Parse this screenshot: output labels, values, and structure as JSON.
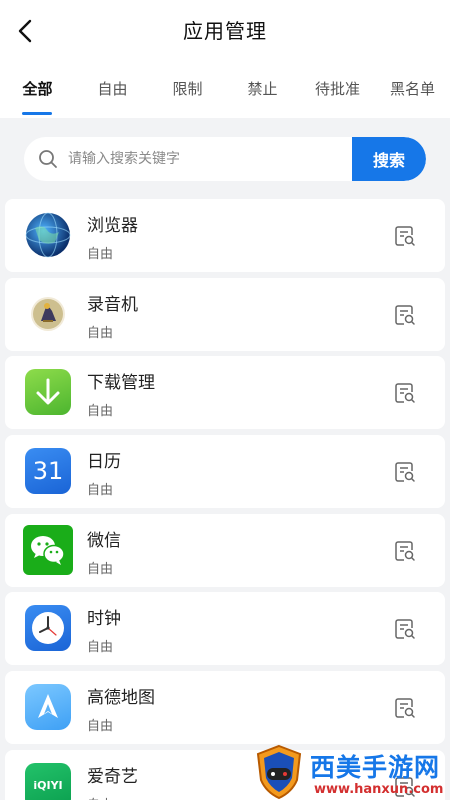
{
  "header": {
    "title": "应用管理",
    "back_icon": "back-arrow-icon"
  },
  "tabs": [
    {
      "label": "全部",
      "active": true
    },
    {
      "label": "自由",
      "active": false
    },
    {
      "label": "限制",
      "active": false
    },
    {
      "label": "禁止",
      "active": false
    },
    {
      "label": "待批准",
      "active": false
    },
    {
      "label": "黑名单",
      "active": false
    }
  ],
  "search": {
    "placeholder": "请输入搜索关键字",
    "value": "",
    "button_label": "搜索"
  },
  "apps": [
    {
      "name": "浏览器",
      "status": "自由",
      "icon": "globe-icon"
    },
    {
      "name": "录音机",
      "status": "自由",
      "icon": "recorder-icon"
    },
    {
      "name": "下载管理",
      "status": "自由",
      "icon": "download-icon"
    },
    {
      "name": "日历",
      "status": "自由",
      "icon": "calendar-icon",
      "icon_text": "31"
    },
    {
      "name": "微信",
      "status": "自由",
      "icon": "wechat-icon"
    },
    {
      "name": "时钟",
      "status": "自由",
      "icon": "clock-icon"
    },
    {
      "name": "高德地图",
      "status": "自由",
      "icon": "amap-icon"
    },
    {
      "name": "爱奇艺",
      "status": "自由",
      "icon": "iqiyi-icon",
      "icon_text": "iQIYI"
    }
  ],
  "watermark": {
    "text": "西美手游网",
    "url": "www.hanxun.com"
  },
  "colors": {
    "accent": "#1677e8",
    "background": "#f2f3f5",
    "card": "#ffffff"
  }
}
